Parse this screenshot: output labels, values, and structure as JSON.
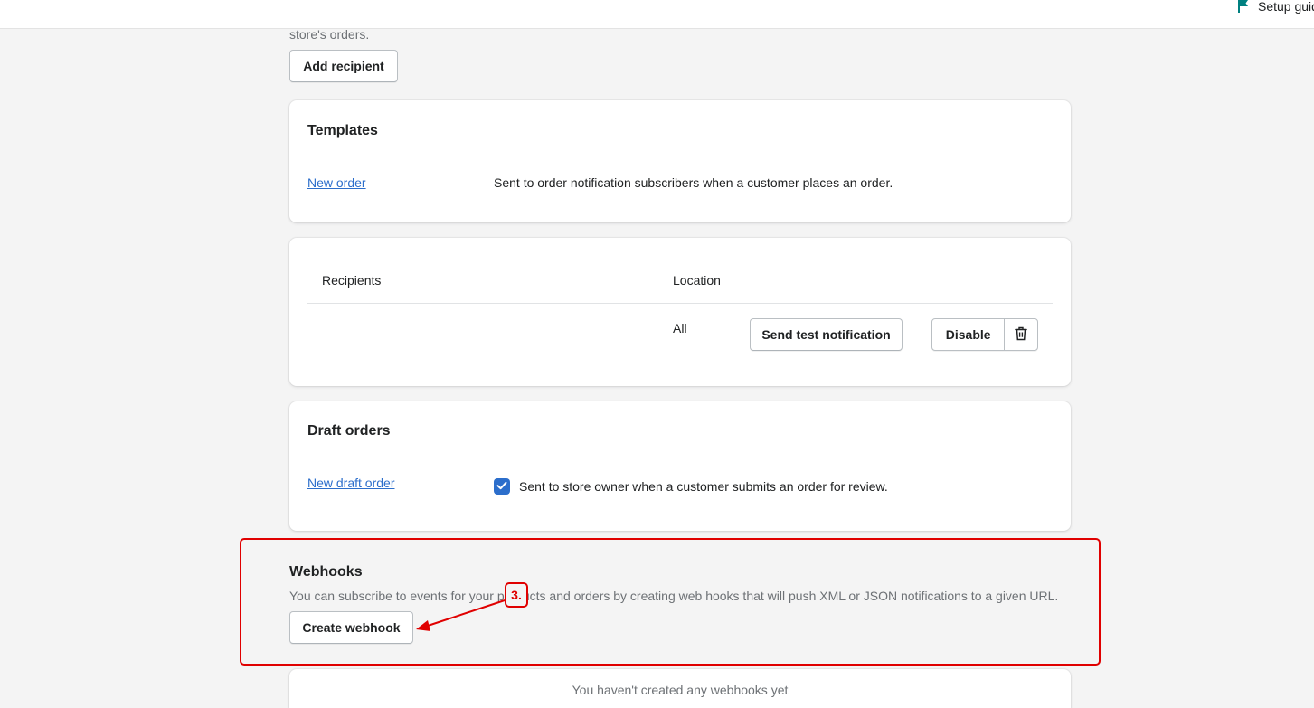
{
  "topbar": {
    "setup_guide_label": "Setup guide"
  },
  "order_notifications": {
    "description_tail": "store's orders.",
    "add_recipient_label": "Add recipient"
  },
  "templates": {
    "title": "Templates",
    "items": [
      {
        "link": "New order",
        "description": "Sent to order notification subscribers when a customer places an order."
      }
    ]
  },
  "recipients": {
    "columns": [
      "Recipients",
      "Location"
    ],
    "rows": [
      {
        "recipient": "",
        "location": "All",
        "send_test_label": "Send test notification",
        "disable_label": "Disable"
      }
    ]
  },
  "draft_orders": {
    "title": "Draft orders",
    "items": [
      {
        "link": "New draft order",
        "checked": true,
        "description": "Sent to store owner when a customer submits an order for review."
      }
    ]
  },
  "webhooks": {
    "title": "Webhooks",
    "description": "You can subscribe to events for your products and orders by creating web hooks that will push XML or JSON notifications to a given URL.",
    "create_label": "Create webhook",
    "empty_state": "You haven't created any webhooks yet"
  },
  "annotation": {
    "step_label": "3.",
    "color": "#e00000"
  },
  "colors": {
    "link": "#2c6ecb",
    "accent": "#2c6ecb",
    "setup_flag": "#008080"
  }
}
